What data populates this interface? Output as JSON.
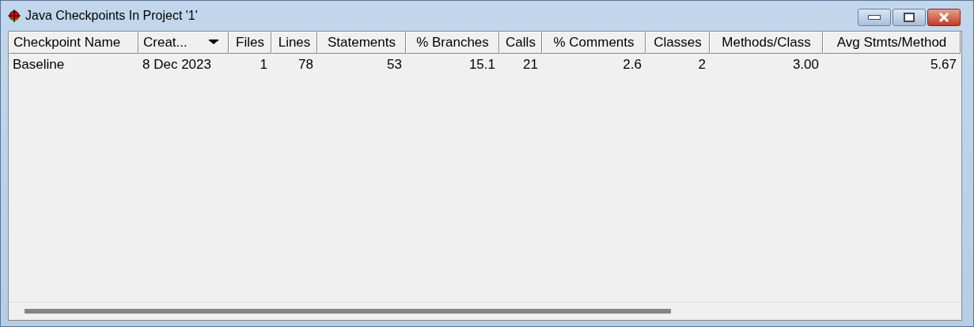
{
  "window": {
    "title": "Java Checkpoints In Project '1'"
  },
  "table": {
    "columns": [
      {
        "label": "Checkpoint Name",
        "sorted": false
      },
      {
        "label": "Creat...",
        "sorted": true
      },
      {
        "label": "Files",
        "sorted": false
      },
      {
        "label": "Lines",
        "sorted": false
      },
      {
        "label": "Statements",
        "sorted": false
      },
      {
        "label": "% Branches",
        "sorted": false
      },
      {
        "label": "Calls",
        "sorted": false
      },
      {
        "label": "% Comments",
        "sorted": false
      },
      {
        "label": "Classes",
        "sorted": false
      },
      {
        "label": "Methods/Class",
        "sorted": false
      },
      {
        "label": "Avg Stmts/Method",
        "sorted": false
      }
    ],
    "rows": [
      {
        "cells": [
          "Baseline",
          "8 Dec 2023",
          "1",
          "78",
          "53",
          "15.1",
          "21",
          "2.6",
          "2",
          "3.00",
          "5.67"
        ]
      }
    ]
  }
}
